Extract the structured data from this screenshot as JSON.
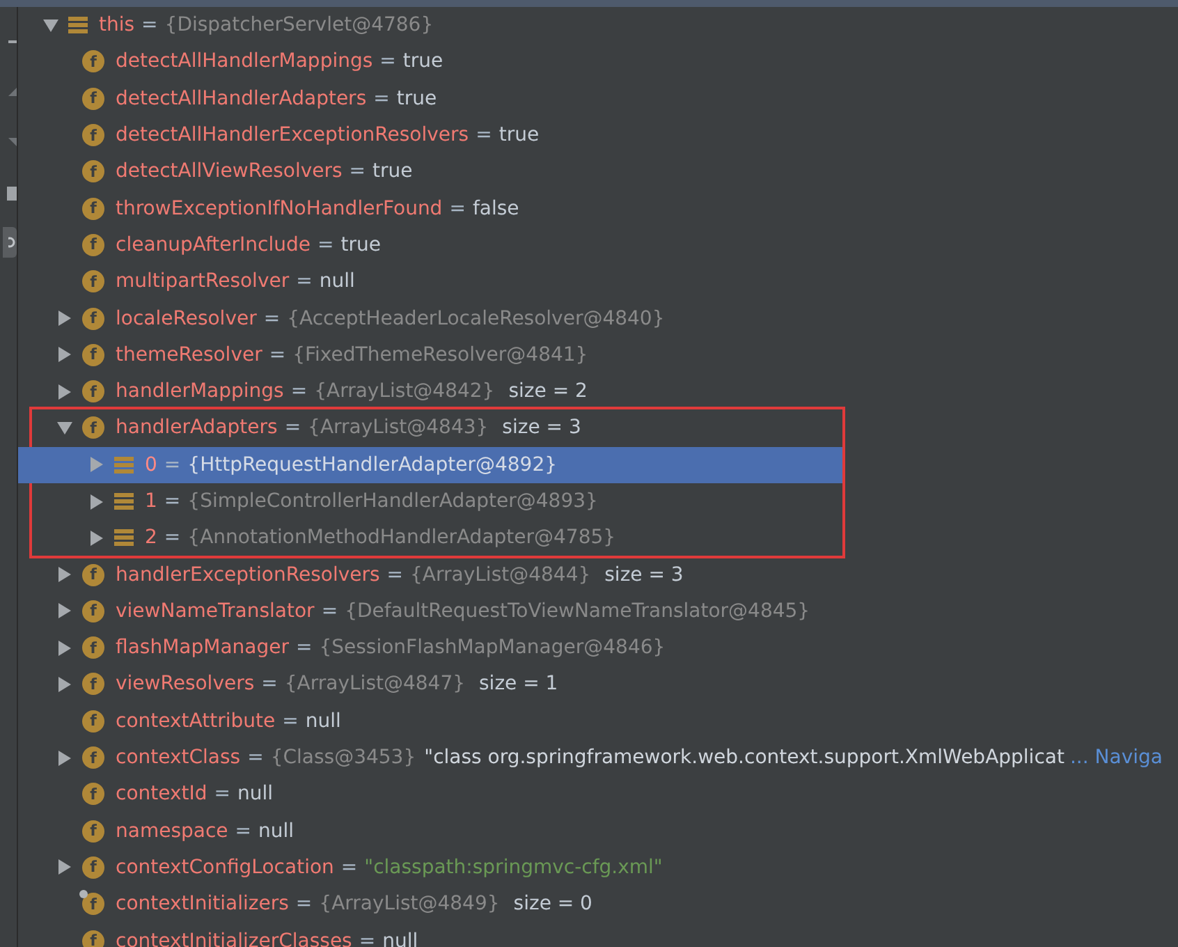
{
  "variables": [
    {
      "name": "this",
      "kind": "object",
      "eq": "=",
      "ref": "{DispatcherServlet@4786}",
      "expandable": true,
      "expanded": true,
      "selected": false,
      "children": [
        {
          "name": "detectAllHandlerMappings",
          "kind": "field",
          "glyph": "f",
          "eq": "=",
          "value": "true",
          "expandable": false,
          "selected": false
        },
        {
          "name": "detectAllHandlerAdapters",
          "kind": "field",
          "glyph": "f",
          "eq": "=",
          "value": "true",
          "expandable": false,
          "selected": false
        },
        {
          "name": "detectAllHandlerExceptionResolvers",
          "kind": "field",
          "glyph": "f",
          "eq": "=",
          "value": "true",
          "expandable": false,
          "selected": false
        },
        {
          "name": "detectAllViewResolvers",
          "kind": "field",
          "glyph": "f",
          "eq": "=",
          "value": "true",
          "expandable": false,
          "selected": false
        },
        {
          "name": "throwExceptionIfNoHandlerFound",
          "kind": "field",
          "glyph": "f",
          "eq": "=",
          "value": "false",
          "expandable": false,
          "selected": false
        },
        {
          "name": "cleanupAfterInclude",
          "kind": "field",
          "glyph": "f",
          "eq": "=",
          "value": "true",
          "expandable": false,
          "selected": false
        },
        {
          "name": "multipartResolver",
          "kind": "field",
          "glyph": "f",
          "eq": "=",
          "value": "null",
          "expandable": false,
          "selected": false
        },
        {
          "name": "localeResolver",
          "kind": "field",
          "glyph": "f",
          "eq": "=",
          "ref": "{AcceptHeaderLocaleResolver@4840}",
          "expandable": true,
          "expanded": false,
          "selected": false
        },
        {
          "name": "themeResolver",
          "kind": "field",
          "glyph": "f",
          "eq": "=",
          "ref": "{FixedThemeResolver@4841}",
          "expandable": true,
          "expanded": false,
          "selected": false
        },
        {
          "name": "handlerMappings",
          "kind": "field",
          "glyph": "f",
          "eq": "=",
          "ref": "{ArrayList@4842}",
          "size": "size = 2",
          "expandable": true,
          "expanded": false,
          "selected": false
        },
        {
          "name": "handlerAdapters",
          "kind": "field",
          "glyph": "f",
          "eq": "=",
          "ref": "{ArrayList@4843}",
          "size": "size = 3",
          "expandable": true,
          "expanded": true,
          "selected": false,
          "highlighted": true,
          "children": [
            {
              "name": "0",
              "kind": "element",
              "eq": "=",
              "ref": "{HttpRequestHandlerAdapter@4892}",
              "expandable": true,
              "expanded": false,
              "selected": true
            },
            {
              "name": "1",
              "kind": "element",
              "eq": "=",
              "ref": "{SimpleControllerHandlerAdapter@4893}",
              "expandable": true,
              "expanded": false,
              "selected": false
            },
            {
              "name": "2",
              "kind": "element",
              "eq": "=",
              "ref": "{AnnotationMethodHandlerAdapter@4785}",
              "expandable": true,
              "expanded": false,
              "selected": false
            }
          ]
        },
        {
          "name": "handlerExceptionResolvers",
          "kind": "field",
          "glyph": "f",
          "eq": "=",
          "ref": "{ArrayList@4844}",
          "size": "size = 3",
          "expandable": true,
          "expanded": false,
          "selected": false
        },
        {
          "name": "viewNameTranslator",
          "kind": "field",
          "glyph": "f",
          "eq": "=",
          "ref": "{DefaultRequestToViewNameTranslator@4845}",
          "expandable": true,
          "expanded": false,
          "selected": false
        },
        {
          "name": "flashMapManager",
          "kind": "field",
          "glyph": "f",
          "eq": "=",
          "ref": "{SessionFlashMapManager@4846}",
          "expandable": true,
          "expanded": false,
          "selected": false
        },
        {
          "name": "viewResolvers",
          "kind": "field",
          "glyph": "f",
          "eq": "=",
          "ref": "{ArrayList@4847}",
          "size": "size = 1",
          "expandable": true,
          "expanded": false,
          "selected": false
        },
        {
          "name": "contextAttribute",
          "kind": "field",
          "glyph": "f",
          "eq": "=",
          "value": "null",
          "expandable": false,
          "selected": false
        },
        {
          "name": "contextClass",
          "kind": "field",
          "glyph": "f",
          "eq": "=",
          "ref": "{Class@3453}",
          "detail": "\"class org.springframework.web.context.support.XmlWebApplicat",
          "link": "... Naviga",
          "expandable": true,
          "expanded": false,
          "selected": false
        },
        {
          "name": "contextId",
          "kind": "field",
          "glyph": "f",
          "eq": "=",
          "value": "null",
          "expandable": false,
          "selected": false
        },
        {
          "name": "namespace",
          "kind": "field",
          "glyph": "f",
          "eq": "=",
          "value": "null",
          "expandable": false,
          "selected": false
        },
        {
          "name": "contextConfigLocation",
          "kind": "field",
          "glyph": "f",
          "eq": "=",
          "string": "\"classpath:springmvc-cfg.xml\"",
          "expandable": true,
          "expanded": false,
          "selected": false
        },
        {
          "name": "contextInitializers",
          "kind": "field",
          "glyph": "f",
          "eq": "=",
          "ref": "{ArrayList@4849}",
          "size": "size = 0",
          "expandable": false,
          "marked": true,
          "selected": false
        },
        {
          "name": "contextInitializerClasses",
          "kind": "field",
          "glyph": "f",
          "eq": "=",
          "value": "null",
          "expandable": false,
          "selected": false
        }
      ]
    }
  ]
}
